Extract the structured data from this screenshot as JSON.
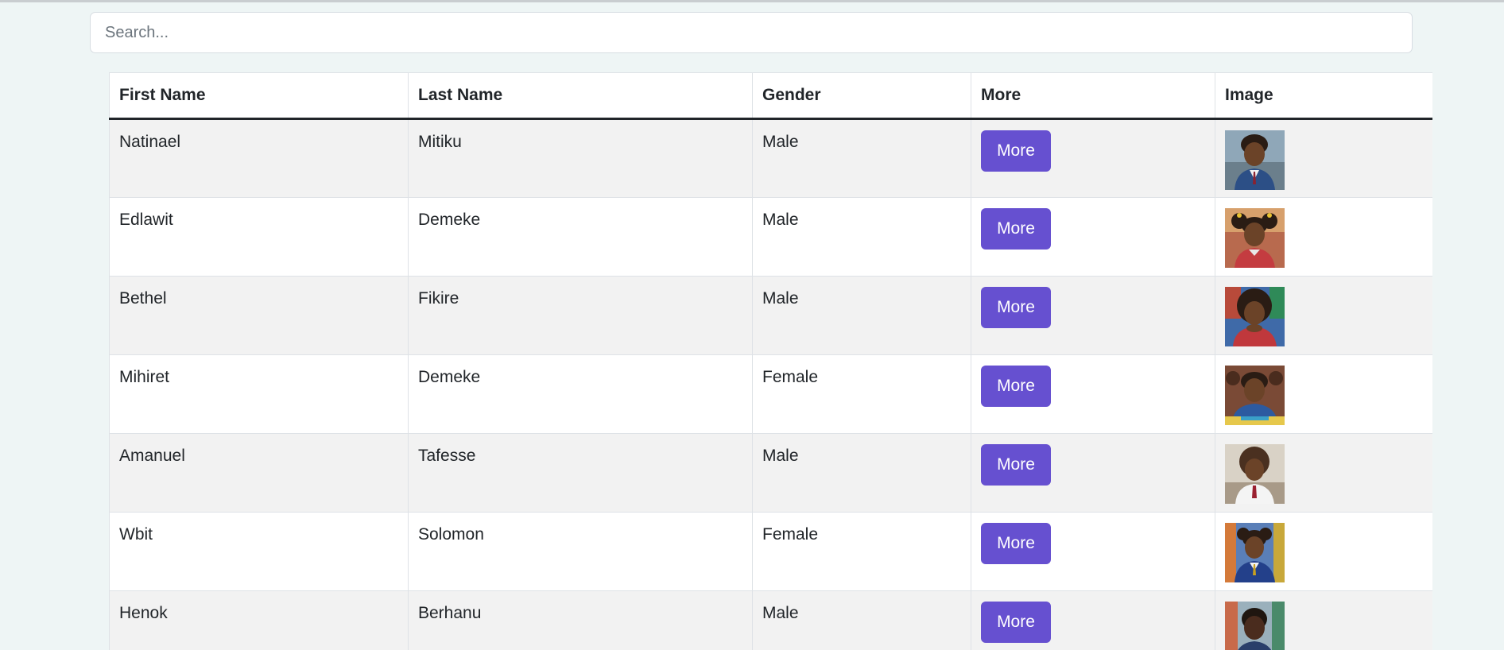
{
  "search": {
    "placeholder": "Search..."
  },
  "table": {
    "headers": [
      "First Name",
      "Last Name",
      "Gender",
      "More",
      "Image"
    ],
    "rows": [
      {
        "first_name": "Natinael",
        "last_name": "Mitiku",
        "gender": "Male",
        "more_label": "More"
      },
      {
        "first_name": "Edlawit",
        "last_name": "Demeke",
        "gender": "Male",
        "more_label": "More"
      },
      {
        "first_name": "Bethel",
        "last_name": "Fikire",
        "gender": "Male",
        "more_label": "More"
      },
      {
        "first_name": "Mihiret",
        "last_name": "Demeke",
        "gender": "Female",
        "more_label": "More"
      },
      {
        "first_name": "Amanuel",
        "last_name": "Tafesse",
        "gender": "Male",
        "more_label": "More"
      },
      {
        "first_name": "Wbit",
        "last_name": "Solomon",
        "gender": "Female",
        "more_label": "More"
      },
      {
        "first_name": "Henok",
        "last_name": "Berhanu",
        "gender": "Male",
        "more_label": "More"
      }
    ]
  },
  "colors": {
    "button": "#6650d0",
    "page_background": "#eef5f5",
    "stripe": "#f2f2f2"
  }
}
